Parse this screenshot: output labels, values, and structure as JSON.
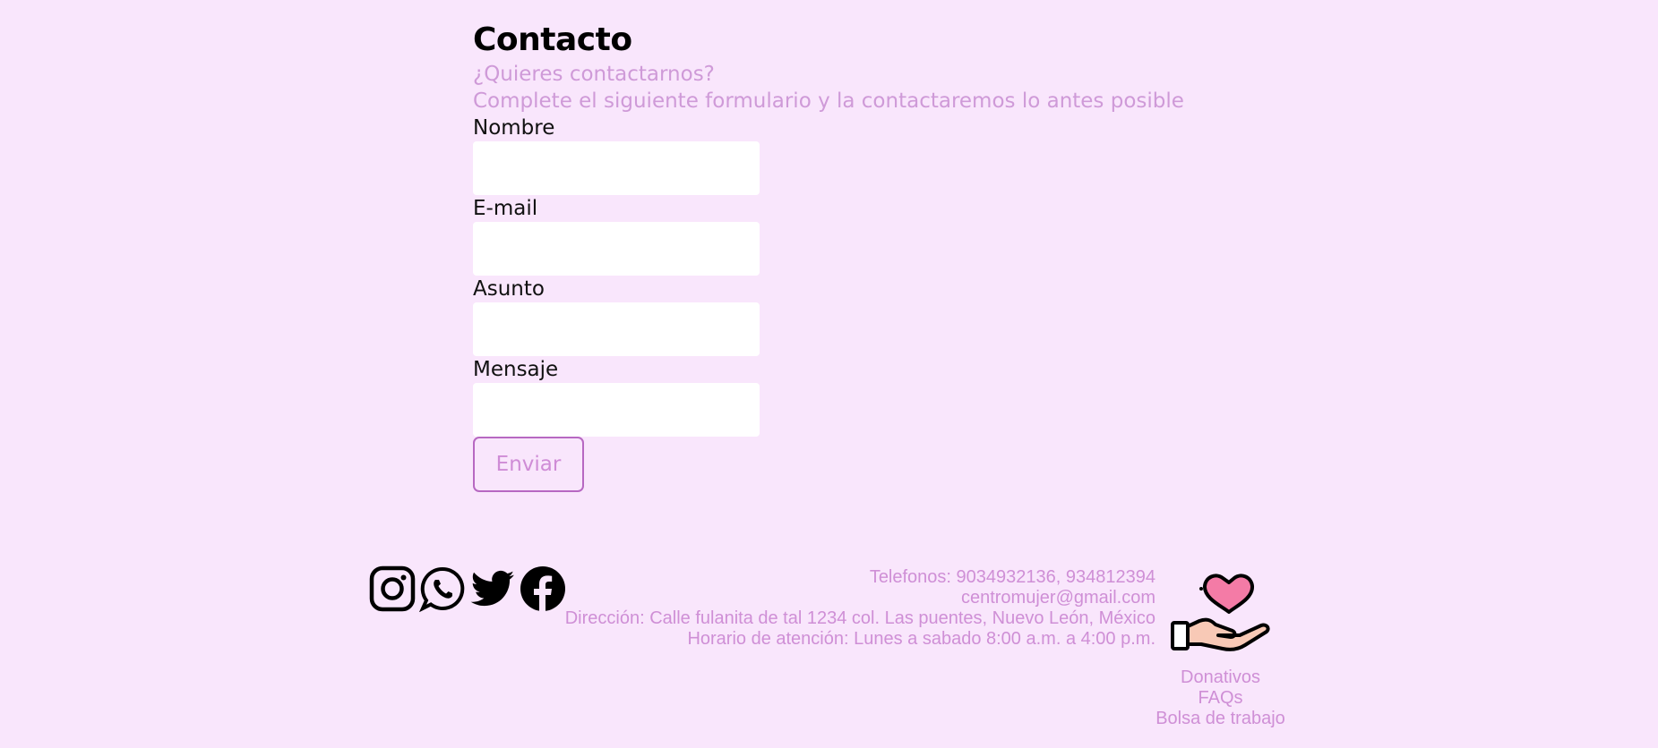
{
  "contact": {
    "title": "Contacto",
    "question": "¿Quieres contactarnos?",
    "description": "Complete el siguiente formulario y la contactaremos lo antes posible",
    "fields": [
      {
        "label": "Nombre",
        "value": ""
      },
      {
        "label": "E-mail",
        "value": ""
      },
      {
        "label": "Asunto",
        "value": ""
      },
      {
        "label": "Mensaje",
        "value": ""
      }
    ],
    "submit_label": "Enviar"
  },
  "social": {
    "icons": [
      "instagram-icon",
      "whatsapp-icon",
      "twitter-icon",
      "facebook-icon"
    ]
  },
  "footer": {
    "phones": "Telefonos: 9034932136, 934812394",
    "email": "centromujer@gmail.com",
    "address": "Dirección: Calle fulanita de tal 1234 col. Las puentes, Nuevo León, México",
    "hours": "Horario de atención: Lunes a sabado 8:00 a.m. a 4:00 p.m.",
    "links": [
      "Donativos",
      "FAQs",
      "Bolsa de trabajo"
    ]
  },
  "colors": {
    "background": "#f9e6fc",
    "accent": "#cf8fd6",
    "button_border": "#b768c2",
    "heart": "#f47ba6",
    "hand": "#f8c9b6"
  }
}
